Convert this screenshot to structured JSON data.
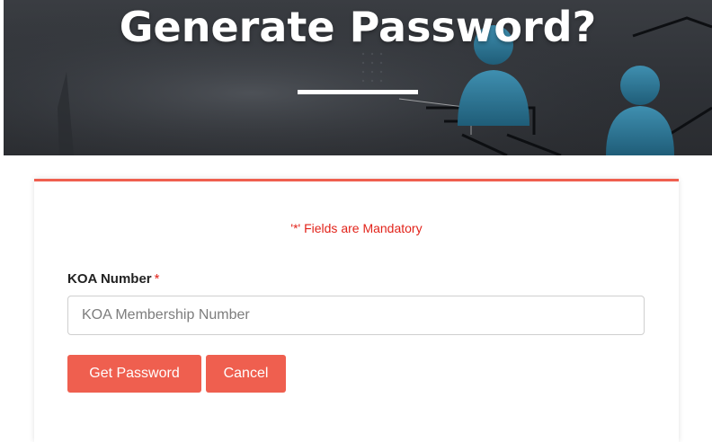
{
  "hero": {
    "title": "Generate Password?"
  },
  "form": {
    "mandatory_note": "'*' Fields are Mandatory",
    "koa_label": "KOA Number",
    "required_marker": "*",
    "koa_placeholder": "KOA Membership Number",
    "koa_value": ""
  },
  "buttons": {
    "get_password": "Get Password",
    "cancel": "Cancel"
  },
  "colors": {
    "accent": "#ef5f4f",
    "required_red": "#e2231a",
    "hero_dark": "#2e3136"
  }
}
